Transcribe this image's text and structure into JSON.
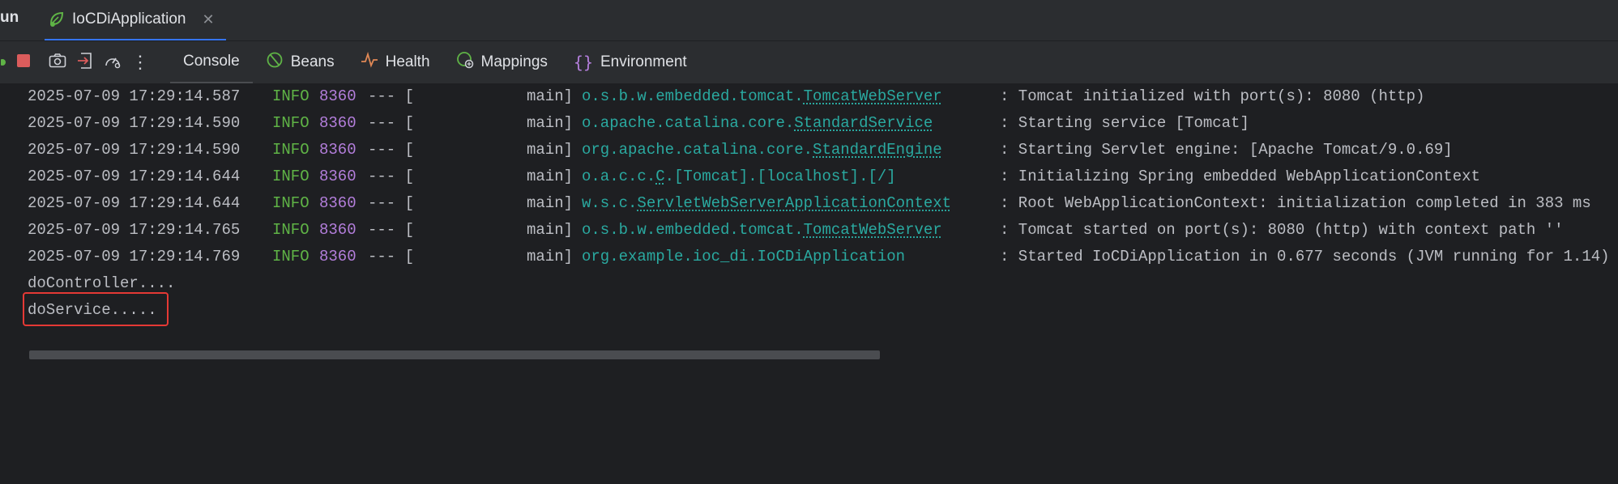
{
  "tabbar": {
    "run_label": "un",
    "run_tab_title": "IoCDiApplication",
    "close_glyph": "✕",
    "icons": {
      "app": "spring-leaf-run-icon"
    }
  },
  "toolbar": {
    "tabs": [
      {
        "label": "Console",
        "icon": ""
      },
      {
        "label": "Beans",
        "icon": "beans-icon"
      },
      {
        "label": "Health",
        "icon": "health-icon"
      },
      {
        "label": "Mappings",
        "icon": "mappings-icon"
      },
      {
        "label": "Environment",
        "icon": "environment-icon"
      }
    ],
    "more_glyph": "⋮",
    "accent_stop": "#db5c5c",
    "accent_run": "#5fb346"
  },
  "console": {
    "log": [
      {
        "ts": "2025-07-09 17:29:14.587",
        "level": "INFO",
        "pid": "8360",
        "sep": "--- [",
        "thread": "main]",
        "logger_pre": "o.s.b.w.embedded.tomcat.",
        "logger_link": "TomcatWebServer",
        "message": ": Tomcat initialized with port(s): 8080 (http)"
      },
      {
        "ts": "2025-07-09 17:29:14.590",
        "level": "INFO",
        "pid": "8360",
        "sep": "--- [",
        "thread": "main]",
        "logger_pre": "o.apache.catalina.core.",
        "logger_link": "StandardService",
        "message": ": Starting service [Tomcat]"
      },
      {
        "ts": "2025-07-09 17:29:14.590",
        "level": "INFO",
        "pid": "8360",
        "sep": "--- [",
        "thread": "main]",
        "logger_pre": "org.apache.catalina.core.",
        "logger_link": "StandardEngine",
        "message": ": Starting Servlet engine: [Apache Tomcat/9.0.69]"
      },
      {
        "ts": "2025-07-09 17:29:14.644",
        "level": "INFO",
        "pid": "8360",
        "sep": "--- [",
        "thread": "main]",
        "logger_pre": "o.a.c.c.",
        "logger_link": "C",
        "logger_post": ".[Tomcat].[localhost].[/]",
        "message": ": Initializing Spring embedded WebApplicationContext"
      },
      {
        "ts": "2025-07-09 17:29:14.644",
        "level": "INFO",
        "pid": "8360",
        "sep": "--- [",
        "thread": "main]",
        "logger_pre": "w.s.c.",
        "logger_link": "ServletWebServerApplicationContext",
        "message": ": Root WebApplicationContext: initialization completed in 383 ms"
      },
      {
        "ts": "2025-07-09 17:29:14.765",
        "level": "INFO",
        "pid": "8360",
        "sep": "--- [",
        "thread": "main]",
        "logger_pre": "o.s.b.w.embedded.tomcat.",
        "logger_link": "TomcatWebServer",
        "message": ": Tomcat started on port(s): 8080 (http) with context path ''"
      },
      {
        "ts": "2025-07-09 17:29:14.769",
        "level": "INFO",
        "pid": "8360",
        "sep": "--- [",
        "thread": "main]",
        "logger_pre": "org.example.ioc_di.IoCDiApplication",
        "logger_link": "",
        "message": ": Started IoCDiApplication in 0.677 seconds (JVM running for 1.14)"
      }
    ],
    "output": [
      "doController....",
      "doService....."
    ]
  }
}
